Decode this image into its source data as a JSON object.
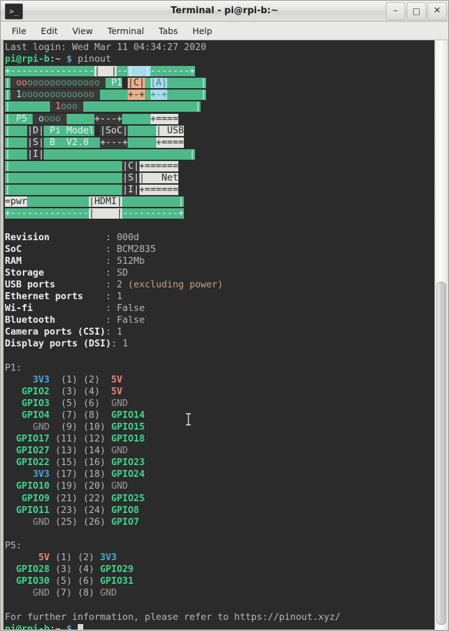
{
  "window": {
    "title": "Terminal - pi@rpi-b:~",
    "icon": "terminal-icon",
    "minimize": "–",
    "maximize": "□",
    "close": "✕"
  },
  "menubar": {
    "items": [
      "File",
      "Edit",
      "View",
      "Terminal",
      "Tabs",
      "Help"
    ]
  },
  "terminal": {
    "login_line": "Last login: Wed Mar 11 04:34:27 2020",
    "prompt_user": "pi@rpi-b",
    "prompt_path": ":~",
    "prompt_sym": "$",
    "command": "pinout",
    "footer_note": "For further information, please refer to https://pinout.xyz/",
    "final_prompt_user": "pi@rpi-b",
    "final_prompt_path": ":~",
    "final_prompt_sym": "$"
  },
  "diagram": {
    "labels": {
      "p1": "P1",
      "p5": "P5",
      "model_line1": "Pi Model",
      "model_line2": "B  V2.0",
      "soc": "SoC",
      "usb": "USB",
      "net": "Net",
      "hdmi": "HDMI",
      "pwr": "=pwr",
      "composite": "C",
      "audio": "A",
      "dsi_d": "D",
      "dsi_s": "S",
      "dsi_i": "I",
      "csi_c": "C",
      "csi_s": "S",
      "csi_i": "I"
    },
    "colors": {
      "board": "#4fb98a",
      "dark_block": "#3a3a3a",
      "light_block": "#e2e2e0",
      "peach_block": "#e8b08c",
      "lightblue_block": "#a9dbe8"
    }
  },
  "specs": {
    "rows": [
      {
        "label": "Revision",
        "sep": ":",
        "value": "000d",
        "note": ""
      },
      {
        "label": "SoC",
        "sep": ":",
        "value": "BCM2835",
        "note": ""
      },
      {
        "label": "RAM",
        "sep": ":",
        "value": "512Mb",
        "note": ""
      },
      {
        "label": "Storage",
        "sep": ":",
        "value": "SD",
        "note": ""
      },
      {
        "label": "USB ports",
        "sep": ":",
        "value": "2",
        "note": "(excluding power)"
      },
      {
        "label": "Ethernet ports",
        "sep": ":",
        "value": "1",
        "note": ""
      },
      {
        "label": "Wi-fi",
        "sep": ":",
        "value": "False",
        "note": ""
      },
      {
        "label": "Bluetooth",
        "sep": ":",
        "value": "False",
        "note": ""
      },
      {
        "label": "Camera ports (CSI)",
        "sep": ":",
        "value": "1",
        "note": ""
      },
      {
        "label": "Display ports (DSI)",
        "sep": ":",
        "value": "1",
        "note": ""
      }
    ]
  },
  "headers": {
    "p1": {
      "title": "P1:",
      "rows": [
        {
          "left": "3V3",
          "left_type": "3v3",
          "ln": "(1)",
          "rn": "(2)",
          "right": "5V",
          "right_type": "5v"
        },
        {
          "left": "GPIO2",
          "left_type": "gpio",
          "ln": "(3)",
          "rn": "(4)",
          "right": "5V",
          "right_type": "5v"
        },
        {
          "left": "GPIO3",
          "left_type": "gpio",
          "ln": "(5)",
          "rn": "(6)",
          "right": "GND",
          "right_type": "gnd"
        },
        {
          "left": "GPIO4",
          "left_type": "gpio",
          "ln": "(7)",
          "rn": "(8)",
          "right": "GPIO14",
          "right_type": "gpio"
        },
        {
          "left": "GND",
          "left_type": "gnd",
          "ln": "(9)",
          "rn": "(10)",
          "right": "GPIO15",
          "right_type": "gpio"
        },
        {
          "left": "GPIO17",
          "left_type": "gpio",
          "ln": "(11)",
          "rn": "(12)",
          "right": "GPIO18",
          "right_type": "gpio"
        },
        {
          "left": "GPIO27",
          "left_type": "gpio",
          "ln": "(13)",
          "rn": "(14)",
          "right": "GND",
          "right_type": "gnd"
        },
        {
          "left": "GPIO22",
          "left_type": "gpio",
          "ln": "(15)",
          "rn": "(16)",
          "right": "GPIO23",
          "right_type": "gpio"
        },
        {
          "left": "3V3",
          "left_type": "3v3",
          "ln": "(17)",
          "rn": "(18)",
          "right": "GPIO24",
          "right_type": "gpio"
        },
        {
          "left": "GPIO10",
          "left_type": "gpio",
          "ln": "(19)",
          "rn": "(20)",
          "right": "GND",
          "right_type": "gnd"
        },
        {
          "left": "GPIO9",
          "left_type": "gpio",
          "ln": "(21)",
          "rn": "(22)",
          "right": "GPIO25",
          "right_type": "gpio"
        },
        {
          "left": "GPIO11",
          "left_type": "gpio",
          "ln": "(23)",
          "rn": "(24)",
          "right": "GPIO8",
          "right_type": "gpio"
        },
        {
          "left": "GND",
          "left_type": "gnd",
          "ln": "(25)",
          "rn": "(26)",
          "right": "GPIO7",
          "right_type": "gpio"
        }
      ]
    },
    "p5": {
      "title": "P5:",
      "rows": [
        {
          "left": "5V",
          "left_type": "5v",
          "ln": "(1)",
          "rn": "(2)",
          "right": "3V3",
          "right_type": "3v3"
        },
        {
          "left": "GPIO28",
          "left_type": "gpio",
          "ln": "(3)",
          "rn": "(4)",
          "right": "GPIO29",
          "right_type": "gpio"
        },
        {
          "left": "GPIO30",
          "left_type": "gpio",
          "ln": "(5)",
          "rn": "(6)",
          "right": "GPIO31",
          "right_type": "gpio"
        },
        {
          "left": "GND",
          "left_type": "gnd",
          "ln": "(7)",
          "rn": "(8)",
          "right": "GND",
          "right_type": "gnd"
        }
      ]
    }
  },
  "scrollbar": {
    "thumb_top_pct": 41,
    "thumb_height_pct": 58
  }
}
